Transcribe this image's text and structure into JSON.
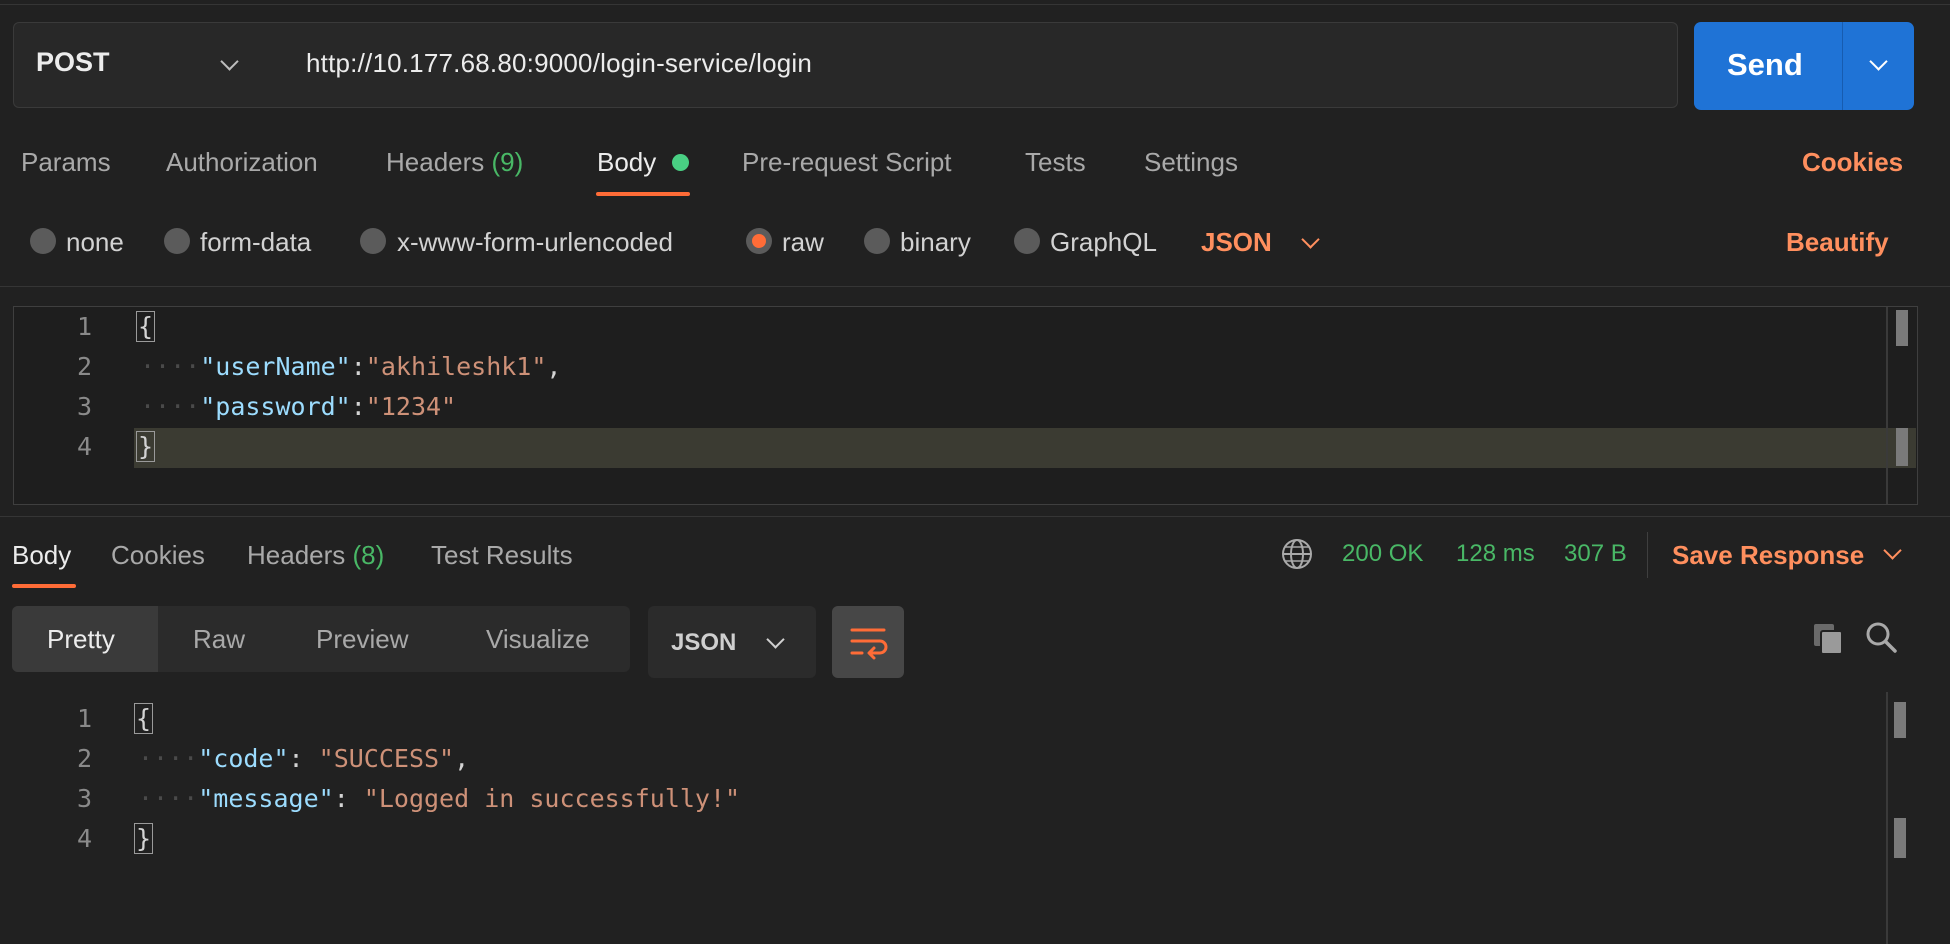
{
  "request": {
    "method": "POST",
    "url": "http://10.177.68.80:9000/login-service/login",
    "send_label": "Send"
  },
  "request_tabs": {
    "params": "Params",
    "authorization": "Authorization",
    "headers": "Headers",
    "headers_count": "(9)",
    "body": "Body",
    "pre_request": "Pre-request Script",
    "tests": "Tests",
    "settings": "Settings",
    "cookies": "Cookies"
  },
  "body_types": {
    "none": "none",
    "form_data": "form-data",
    "urlencoded": "x-www-form-urlencoded",
    "raw": "raw",
    "binary": "binary",
    "graphql": "GraphQL",
    "format": "JSON",
    "selected": "raw",
    "beautify": "Beautify"
  },
  "request_body": {
    "line_numbers": [
      "1",
      "2",
      "3",
      "4"
    ],
    "open_brace": "{",
    "close_brace": "}",
    "indent": "····",
    "key1": "\"userName\"",
    "val1": "\"akhileshk1\"",
    "key2": "\"password\"",
    "val2": "\"1234\"",
    "colon": ":",
    "comma": ","
  },
  "response_tabs": {
    "body": "Body",
    "cookies": "Cookies",
    "headers": "Headers",
    "headers_count": "(8)",
    "test_results": "Test Results"
  },
  "response_status": {
    "status": "200 OK",
    "time": "128 ms",
    "size": "307 B",
    "save": "Save Response"
  },
  "response_view": {
    "pretty": "Pretty",
    "raw": "Raw",
    "preview": "Preview",
    "visualize": "Visualize",
    "format": "JSON"
  },
  "response_body": {
    "line_numbers": [
      "1",
      "2",
      "3",
      "4"
    ],
    "open_brace": "{",
    "close_brace": "}",
    "indent": "····",
    "key1": "\"code\"",
    "val1": "\"SUCCESS\"",
    "key2": "\"message\"",
    "val2": "\"Logged in successfully!\"",
    "colon": ": ",
    "comma": ","
  },
  "colors": {
    "accent": "#ff6c37",
    "send_button": "#1f73d6",
    "success": "#49b866",
    "background": "#212121"
  },
  "icons": [
    "chevron-down-icon",
    "globe-icon",
    "copy-icon",
    "search-icon",
    "wrap-lines-icon"
  ]
}
